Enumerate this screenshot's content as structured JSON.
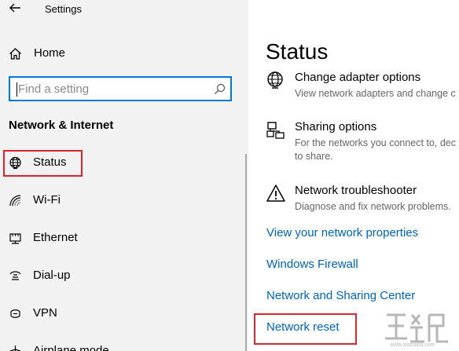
{
  "window": {
    "title": "Settings"
  },
  "sidebar": {
    "home_label": "Home",
    "search": {
      "placeholder": "Find a setting"
    },
    "section_title": "Network & Internet",
    "items": [
      {
        "label": "Status",
        "icon": "globe-icon",
        "highlighted": true
      },
      {
        "label": "Wi-Fi",
        "icon": "wifi-icon"
      },
      {
        "label": "Ethernet",
        "icon": "ethernet-icon"
      },
      {
        "label": "Dial-up",
        "icon": "dialup-icon"
      },
      {
        "label": "VPN",
        "icon": "vpn-icon"
      },
      {
        "label": "Airplane mode",
        "icon": "airplane-icon"
      }
    ]
  },
  "main": {
    "page_title": "Status",
    "options": [
      {
        "title": "Change adapter options",
        "description": "View network adapters and change c",
        "icon": "globe-adapter-icon"
      },
      {
        "title": "Sharing options",
        "description_lines": [
          "For the networks you connect to, dec",
          "to share."
        ],
        "icon": "sharing-icon"
      },
      {
        "title": "Network troubleshooter",
        "description": "Diagnose and fix network problems.",
        "icon": "warning-icon"
      }
    ],
    "links": [
      "View your network properties",
      "Windows Firewall",
      "Network and Sharing Center",
      "Network reset"
    ]
  },
  "colors": {
    "accent": "#0078d7",
    "link": "#0063b1",
    "highlight_border": "#d9252f",
    "sidebar_bg": "#f2f2f2"
  },
  "watermark": {
    "domain": "www.xiazaiba.com"
  }
}
